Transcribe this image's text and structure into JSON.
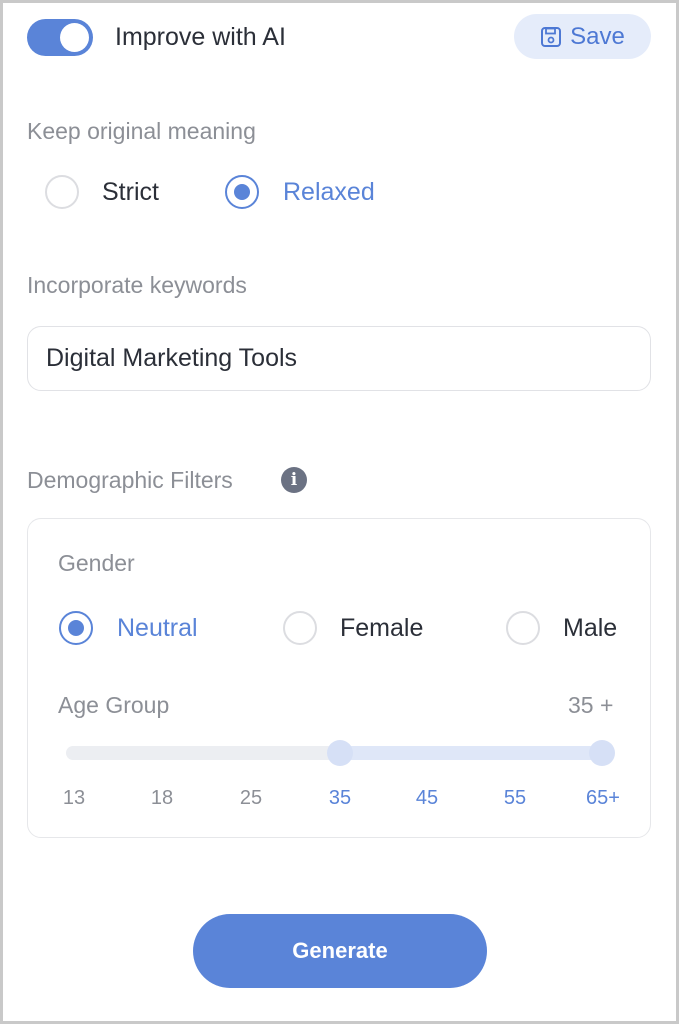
{
  "header": {
    "toggle_label": "Improve with AI",
    "toggle_on": true,
    "save_label": "Save"
  },
  "meaning": {
    "label": "Keep original meaning",
    "options": [
      "Strict",
      "Relaxed"
    ],
    "selected": "Relaxed"
  },
  "keywords": {
    "label": "Incorporate keywords",
    "value": "Digital Marketing Tools"
  },
  "demographics": {
    "label": "Demographic Filters",
    "gender": {
      "label": "Gender",
      "options": [
        "Neutral",
        "Female",
        "Male"
      ],
      "selected": "Neutral"
    },
    "age": {
      "label": "Age Group",
      "value_display": "35 +",
      "range": [
        "35",
        "65+"
      ],
      "ticks": [
        "13",
        "18",
        "25",
        "35",
        "45",
        "55",
        "65+"
      ]
    }
  },
  "actions": {
    "generate_label": "Generate"
  },
  "colors": {
    "accent": "#5a84d8",
    "accent_light": "#e5ecfa",
    "muted_text": "#8c8f96",
    "dark_text": "#2b2f38"
  }
}
